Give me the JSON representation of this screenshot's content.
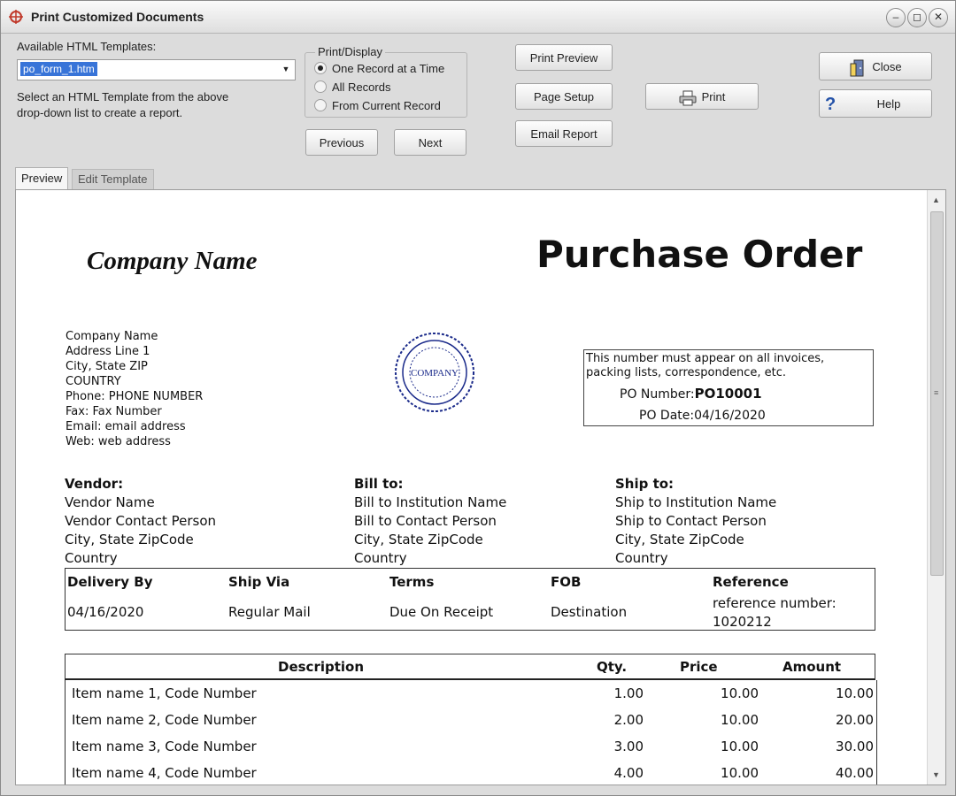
{
  "window": {
    "title": "Print Customized Documents",
    "controls": [
      "–",
      "◻",
      "✕"
    ]
  },
  "toolbar": {
    "templates_label": "Available HTML Templates:",
    "template_value": "po_form_1.htm",
    "hint_line1": "Select an HTML Template from the above",
    "hint_line2": "drop-down list to create a report.",
    "print_display_label": "Print/Display",
    "radio_options": [
      "One Record at a Time",
      "All Records",
      "From Current Record"
    ],
    "previous_label": "Previous",
    "next_label": "Next",
    "print_preview_label": "Print Preview",
    "page_setup_label": "Page Setup",
    "email_report_label": "Email Report",
    "print_label": "Print",
    "close_label": "Close",
    "help_label": "Help"
  },
  "tabs": {
    "preview": "Preview",
    "edit_template": "Edit Template"
  },
  "document": {
    "company_name": "Company Name",
    "title": "Purchase Order",
    "address_lines": [
      "Company Name",
      "Address Line 1",
      "City, State ZIP",
      "COUNTRY",
      "Phone: PHONE NUMBER",
      "Fax: Fax Number",
      "Email: email address",
      "Web: web address"
    ],
    "seal_text": "COMPANY",
    "po_note": "This number must appear on all invoices, packing lists, correspondence, etc.",
    "po_number_label": "PO Number:",
    "po_number": "PO10001",
    "po_date_label": "PO Date:",
    "po_date": "04/16/2020",
    "vendor": {
      "title": "Vendor:",
      "lines": [
        "Vendor Name",
        "Vendor Contact Person",
        "City, State ZipCode",
        "Country"
      ]
    },
    "bill_to": {
      "title": "Bill to:",
      "lines": [
        "Bill to Institution Name",
        "Bill to Contact Person",
        "City, State ZipCode",
        "Country"
      ]
    },
    "ship_to": {
      "title": "Ship to:",
      "lines": [
        "Ship to Institution Name",
        "Ship to Contact Person",
        "City, State ZipCode",
        "Country"
      ]
    },
    "terms": {
      "headers": [
        "Delivery By",
        "Ship Via",
        "Terms",
        "FOB",
        "Reference"
      ],
      "values": [
        "04/16/2020",
        "Regular Mail",
        "Due On Receipt",
        "Destination",
        "reference number:"
      ],
      "reference_number": "1020212"
    },
    "items": {
      "headers": [
        "Description",
        "Qty.",
        "Price",
        "Amount"
      ],
      "rows": [
        [
          "Item name 1, Code Number",
          "1.00",
          "10.00",
          "10.00"
        ],
        [
          "Item name 2, Code Number",
          "2.00",
          "10.00",
          "20.00"
        ],
        [
          "Item name 3, Code Number",
          "3.00",
          "10.00",
          "30.00"
        ],
        [
          "Item name 4, Code Number",
          "4.00",
          "10.00",
          "40.00"
        ]
      ]
    }
  }
}
